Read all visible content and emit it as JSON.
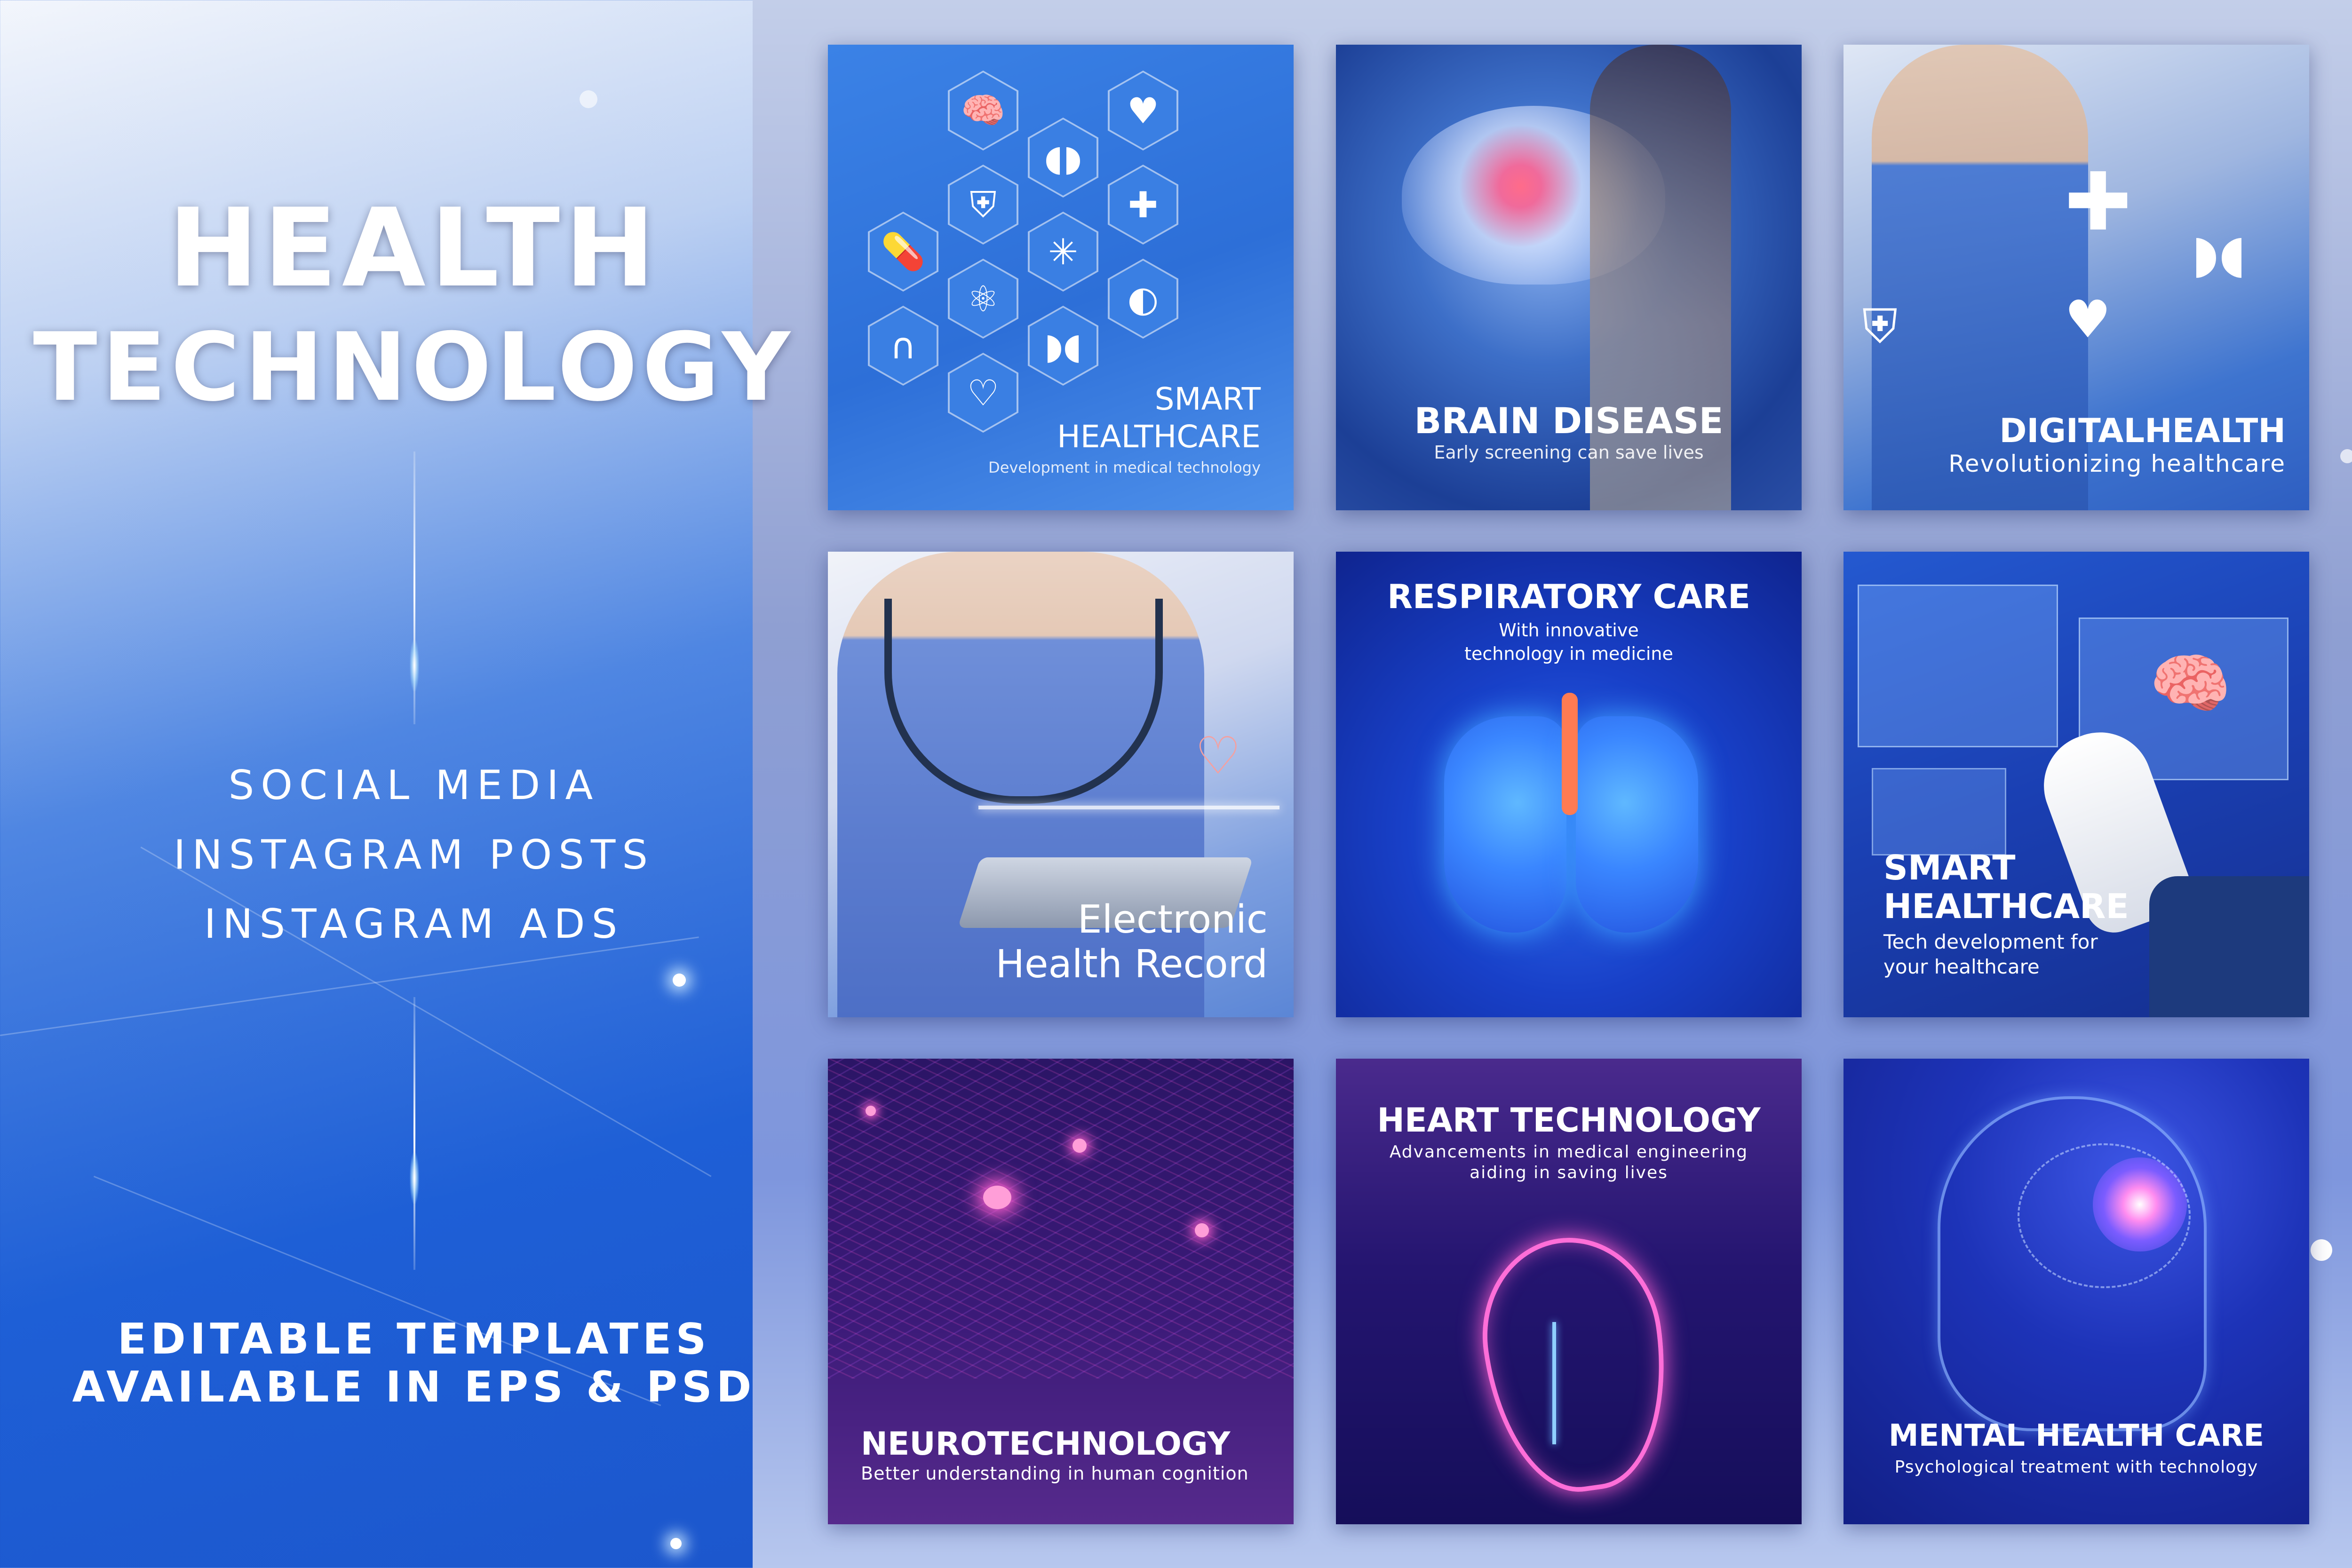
{
  "header": {
    "title_line1": "HEALTH",
    "title_line2": "TECHNOLOGY"
  },
  "media_types": [
    "SOCIAL MEDIA",
    "INSTAGRAM POSTS",
    "INSTAGRAM ADS"
  ],
  "cta": {
    "line1": "EDITABLE TEMPLATES",
    "line2": "AVAILABLE IN EPS & PSD"
  },
  "cards": [
    {
      "title_l1": "SMART",
      "title_l2": "HEALTHCARE",
      "subtitle": "Development in medical technology",
      "icons": [
        "brain-icon",
        "heart-icon",
        "kidneys-icon",
        "shield-icon",
        "plus-icon",
        "pills-icon",
        "neuron-icon",
        "atom-icon",
        "stomach-icon",
        "intestine-icon",
        "lungs-icon",
        "heartbeat-icon"
      ]
    },
    {
      "title": "BRAIN DISEASE",
      "subtitle": "Early screening can save lives"
    },
    {
      "title": "DIGITALHEALTH",
      "subtitle": "Revolutionizing healthcare"
    },
    {
      "title_l1": "Electronic",
      "title_l2": "Health Record"
    },
    {
      "title": "RESPIRATORY CARE",
      "subtitle_l1": "With innovative",
      "subtitle_l2": "technology in medicine"
    },
    {
      "title_l1": "SMART",
      "title_l2": "HEALTHCARE",
      "subtitle_l1": "Tech development for",
      "subtitle_l2": "your healthcare"
    },
    {
      "title": "NEUROTECHNOLOGY",
      "subtitle": "Better understanding in human cognition"
    },
    {
      "title": "HEART TECHNOLOGY",
      "subtitle_l1": "Advancements in medical engineering",
      "subtitle_l2": "aiding in saving lives"
    },
    {
      "title": "MENTAL HEALTH CARE",
      "subtitle": "Psychological treatment with technology"
    }
  ],
  "colors": {
    "brand_blue": "#1e5fd6",
    "neon_pink": "#ff5fd0",
    "text_white": "#ffffff"
  }
}
